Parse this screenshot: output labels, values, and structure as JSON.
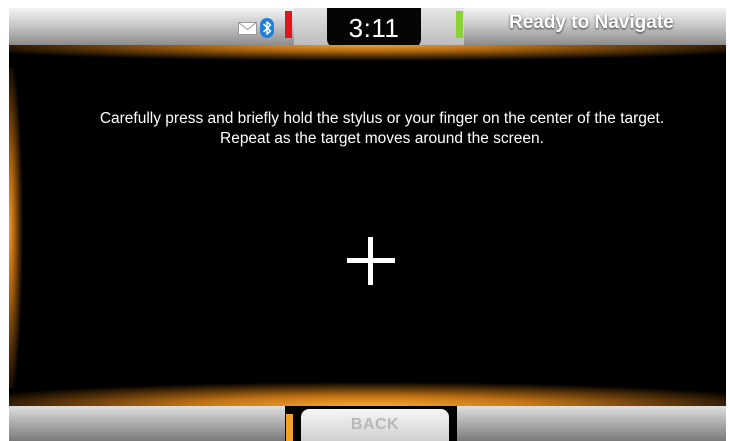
{
  "status_bar": {
    "clock": "3:11",
    "status": "Ready to Navigate",
    "icons": [
      "mail-icon",
      "bluetooth-icon"
    ],
    "marker_colors": {
      "left": "#e3141c",
      "right": "#8cd33a"
    }
  },
  "instructions": {
    "line1": "Carefully press and briefly hold the stylus or your finger on the center of the target.",
    "line2": "Repeat as the target moves around the screen."
  },
  "target": {
    "icon": "crosshair-target-icon"
  },
  "bottom_bar": {
    "back_label": "BACK",
    "marker_colors": {
      "left": "#f0a12c",
      "right": "#4c63c8"
    }
  },
  "accent_color": "#f0a12c"
}
